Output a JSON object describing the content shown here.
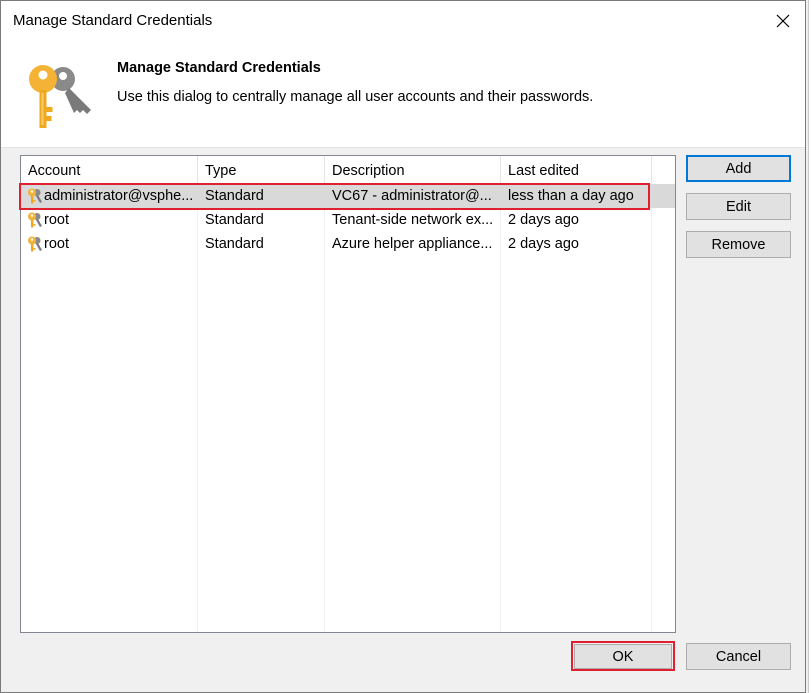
{
  "window": {
    "title": "Manage Standard Credentials",
    "close_icon": "close-icon"
  },
  "banner": {
    "title": "Manage Standard Credentials",
    "description": "Use this dialog to centrally manage all user accounts and their passwords.",
    "icon": "keys-icon"
  },
  "table": {
    "columns": [
      "Account",
      "Type",
      "Description",
      "Last edited"
    ],
    "rows": [
      {
        "account": "administrator@vsphe...",
        "type": "Standard",
        "description": "VC67 - administrator@...",
        "last_edited": "less than a day ago",
        "selected": true
      },
      {
        "account": "root",
        "type": "Standard",
        "description": "Tenant-side network ex...",
        "last_edited": "2 days ago",
        "selected": false
      },
      {
        "account": "root",
        "type": "Standard",
        "description": "Azure helper appliance...",
        "last_edited": "2 days ago",
        "selected": false
      }
    ]
  },
  "buttons": {
    "add": "Add",
    "edit": "Edit",
    "remove": "Remove",
    "ok": "OK",
    "cancel": "Cancel"
  },
  "colors": {
    "highlight": "#e0202e",
    "key_gold": "#f5b335",
    "key_gray": "#7a7a7a",
    "focus_blue": "#0078d7"
  }
}
